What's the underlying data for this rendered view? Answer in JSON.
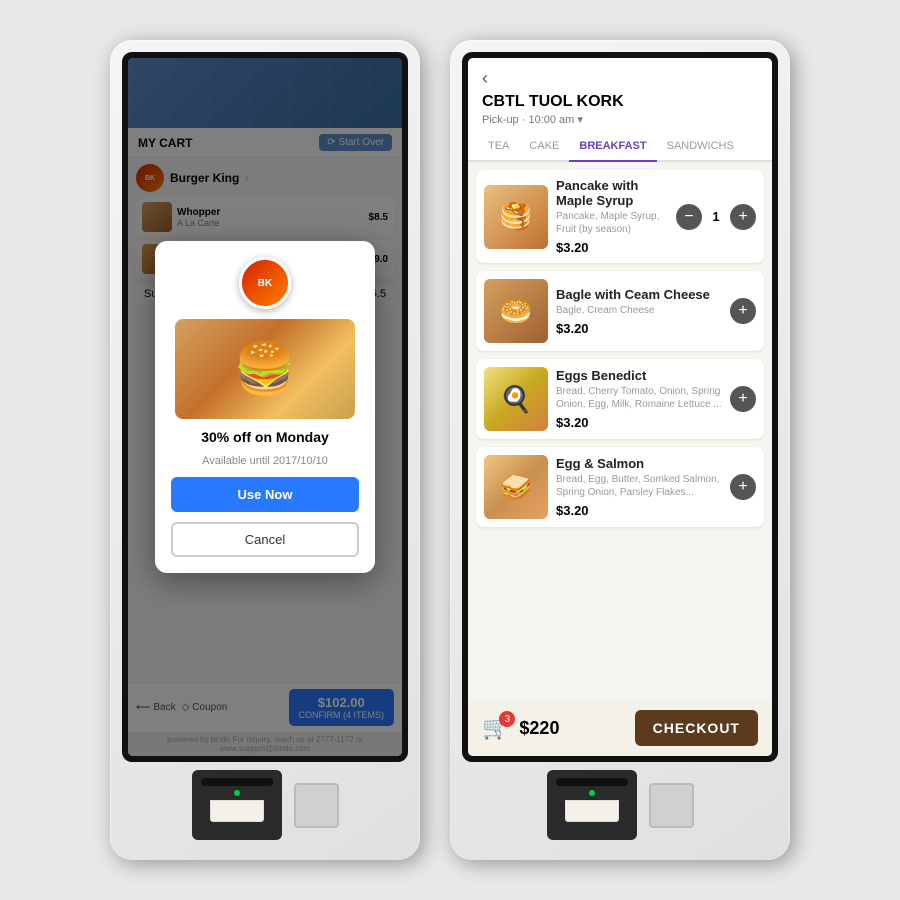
{
  "leftKiosk": {
    "cartHeader": {
      "title": "MY CART",
      "startOverLabel": "⟳ Start Over"
    },
    "brand": "Burger King",
    "items": [
      {
        "name": "Subtotal",
        "price": "$25.5"
      }
    ],
    "dialog": {
      "logoText": "BK",
      "promoTitle": "30% off on Monday",
      "promoSub": "Available until 2017/10/10",
      "useNowLabel": "Use Now",
      "cancelLabel": "Cancel"
    },
    "bottomBar": {
      "backLabel": "Back",
      "couponLabel": "Coupon",
      "confirmPrice": "$102.00",
      "confirmSub": "CONFIRM (4 ITEMS)"
    },
    "poweredBy": "powered by bindo      For inquiry, reach us at 2777-1172 or www.support@bindo.com"
  },
  "rightKiosk": {
    "header": {
      "storeName": "CBTL TUOL KORK",
      "storeSub": "Pick-up · 10:00 am ▾"
    },
    "tabs": [
      "TEA",
      "CAKE",
      "BREAKFAST",
      "SANDWICHS"
    ],
    "activeTab": "BREAKFAST",
    "menuItems": [
      {
        "name": "Pancake with Maple Syrup",
        "desc": "Pancake, Maple Syrup, Fruit (by season)",
        "price": "$3.20",
        "qty": 1,
        "hasQtyControl": true
      },
      {
        "name": "Bagle with Ceam Cheese",
        "desc": "Bagle, Cream Cheese",
        "price": "$3.20",
        "qty": null,
        "hasQtyControl": false
      },
      {
        "name": "Eggs Benedict",
        "desc": "Bread, Cherry Tomato, Onion, Spring Onion, Egg, Milk, Romaine Lettuce ...",
        "price": "$3.20",
        "qty": null,
        "hasQtyControl": false
      },
      {
        "name": "Egg & Salmon",
        "desc": "Bread, Egg, Butter, Somked Salmon, Spring Onion, Parsley Flakes...",
        "price": "$3.20",
        "qty": null,
        "hasQtyControl": false
      }
    ],
    "checkout": {
      "cartCount": 3,
      "total": "$220",
      "checkoutLabel": "CHECKOUT"
    }
  }
}
